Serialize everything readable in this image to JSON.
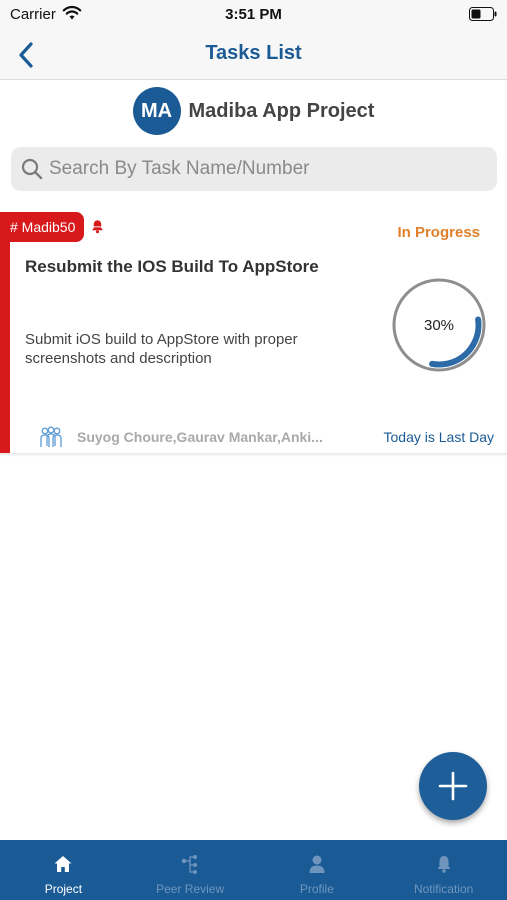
{
  "status_bar": {
    "carrier": "Carrier",
    "time": "3:51 PM"
  },
  "nav": {
    "title": "Tasks List"
  },
  "project": {
    "initials": "MA",
    "name": "Madiba App Project"
  },
  "search": {
    "placeholder": "Search By Task Name/Number"
  },
  "task": {
    "tag": "# Madib50",
    "status": "In Progress",
    "title": "Resubmit the IOS Build To AppStore",
    "description": "Submit iOS build to AppStore with proper screenshots and description",
    "progress_text": "30%",
    "progress_value": 0.3,
    "assignees": "Suyog Choure,Gaurav Mankar,Anki...",
    "due": "Today is Last Day"
  },
  "tabs": [
    {
      "label": "Project",
      "icon": "home-icon",
      "active": true
    },
    {
      "label": "Peer Review",
      "icon": "peer-review-icon",
      "active": false
    },
    {
      "label": "Profile",
      "icon": "profile-icon",
      "active": false
    },
    {
      "label": "Notification",
      "icon": "bell-icon",
      "active": false
    }
  ],
  "colors": {
    "primary": "#1a5b95",
    "tag_red": "#d7191b",
    "status_orange": "#e27f29",
    "tab_inactive": "#6f95bd"
  }
}
